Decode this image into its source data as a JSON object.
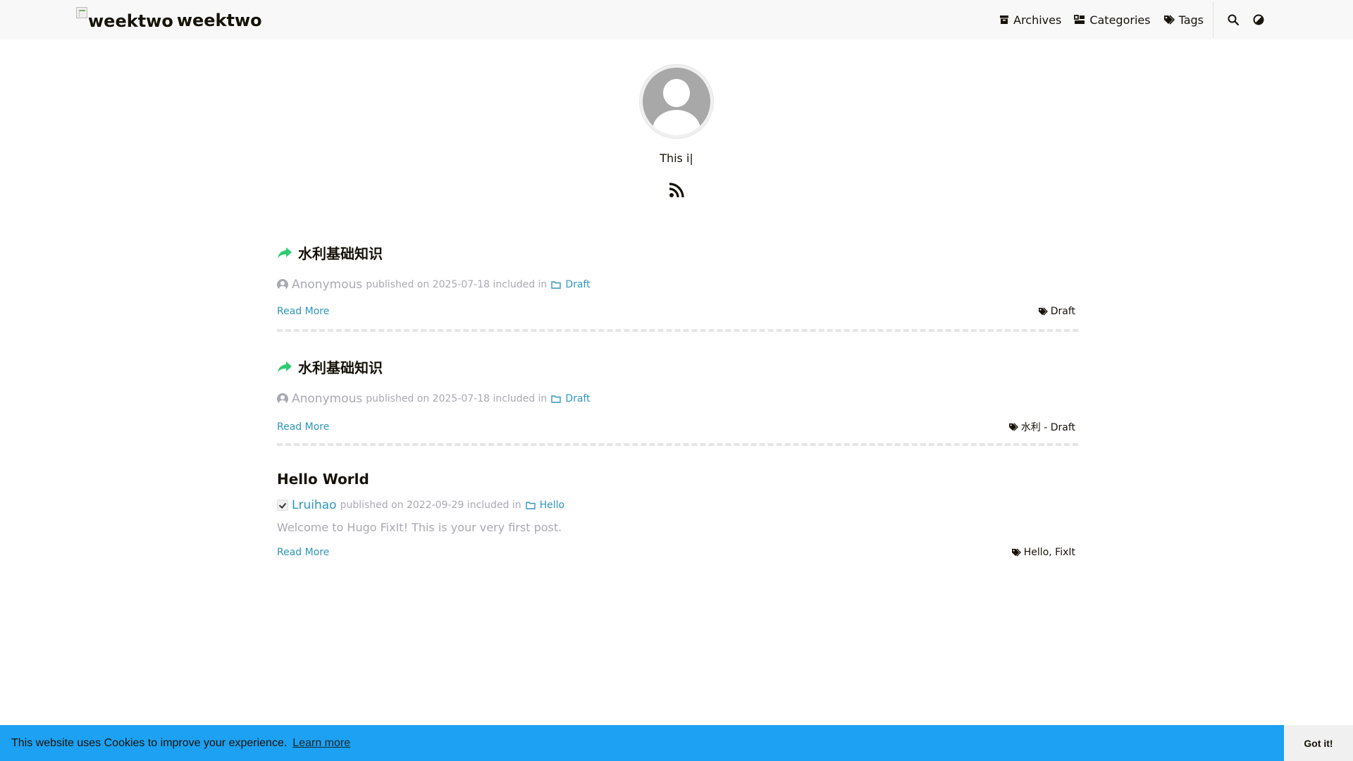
{
  "header": {
    "logo_alt": "weektwo",
    "title": "weektwo",
    "nav": [
      {
        "label": "Archives",
        "icon": "archive-icon"
      },
      {
        "label": "Categories",
        "icon": "categories-icon"
      },
      {
        "label": "Tags",
        "icon": "tags-icon"
      }
    ],
    "search_icon": "search-icon",
    "theme_icon": "theme-toggle-icon"
  },
  "profile": {
    "subtitle": "This i|",
    "rss_icon": "rss-icon"
  },
  "posts": [
    {
      "title": "水利基础知识",
      "icon": "share-arrow-icon",
      "author": "Anonymous",
      "published": "published on 2025-07-18 included in",
      "category": "Draft",
      "read_more": "Read More",
      "tags": "Draft"
    },
    {
      "title": "水利基础知识",
      "icon": "share-arrow-icon",
      "author": "Anonymous",
      "published": "published on 2025-07-18 included in",
      "category": "Draft",
      "read_more": "Read More",
      "tags": "水利 - Draft"
    },
    {
      "title": "Hello World",
      "author": "Lruihao",
      "published": "published on 2022-09-29 included in",
      "category": "Hello",
      "summary": "Welcome to Hugo FixIt! This is your very first post.",
      "read_more": "Read More",
      "tags": "Hello, FixIt"
    }
  ],
  "cookie": {
    "message": "This website uses Cookies to improve your experience.",
    "learn_more": "Learn more",
    "accept": "Got it!"
  },
  "colors": {
    "accent": "#2d96bd",
    "cookie_bg": "#1da1f2",
    "share_icon": "#2ecc71",
    "meta": "#a9a9b3"
  }
}
